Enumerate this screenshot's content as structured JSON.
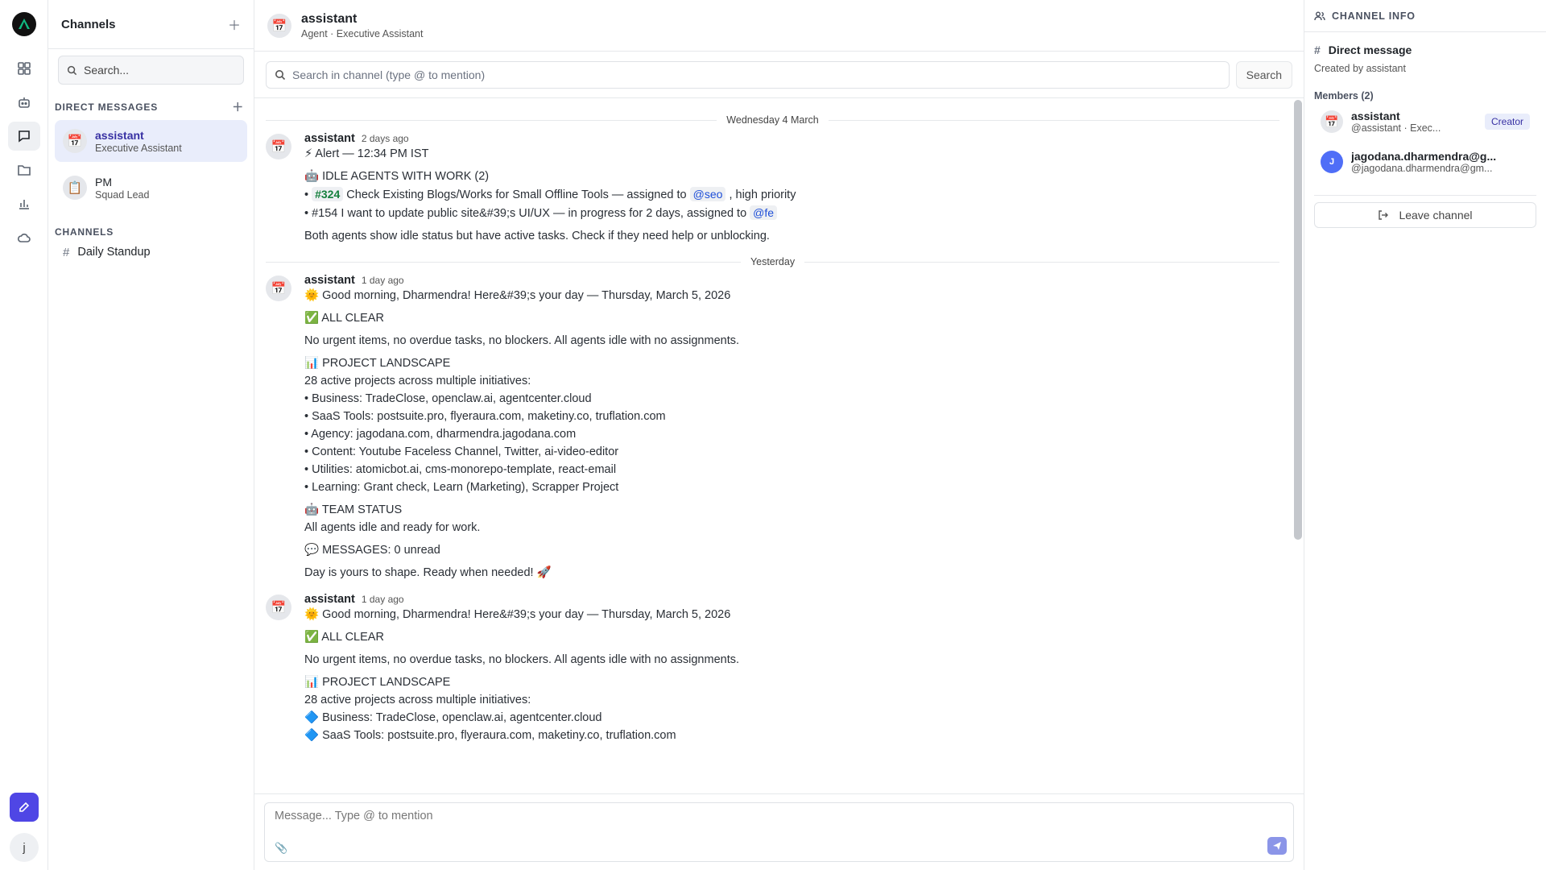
{
  "rail": {
    "nav_icons": [
      "dashboard-icon",
      "bot-icon",
      "chat-icon",
      "folder-icon",
      "chart-icon",
      "cloud-icon"
    ],
    "user_initial": "j",
    "accent": "#4f46e5"
  },
  "sidebar": {
    "title": "Channels",
    "search_placeholder": "Search...",
    "direct_messages_title": "DIRECT MESSAGES",
    "direct_messages": [
      {
        "name": "assistant",
        "role": "Executive Assistant",
        "icon": "📅"
      },
      {
        "name": "PM",
        "role": "Squad Lead",
        "icon": "📋"
      }
    ],
    "channels_title": "CHANNELS",
    "channels": [
      {
        "name": "Daily Standup"
      }
    ]
  },
  "header": {
    "name": "assistant",
    "subtitle": "Agent · Executive Assistant",
    "icon": "📅"
  },
  "channel_search": {
    "placeholder": "Search in channel (type @ to mention)",
    "button": "Search"
  },
  "feed": {
    "divider_1": "Wednesday 4 March",
    "divider_2": "Yesterday",
    "msg1": {
      "author": "assistant",
      "time": "2 days ago",
      "l1": "⚡ Alert — 12:34 PM IST",
      "l2": "🤖 IDLE AGENTS WITH WORK (2)",
      "l3_prefix": "• ",
      "l3_tag": "#324",
      "l3_text": " Check Existing Blogs/Works for Small Offline Tools — assigned to ",
      "l3_mention": "@seo",
      "l3_suffix": " , high priority",
      "l4_text": "• #154 I want to update public site&#39;s UI/UX — in progress for 2 days, assigned to ",
      "l4_mention": "@fe",
      "l5": "Both agents show idle status but have active tasks. Check if they need help or unblocking."
    },
    "msg2": {
      "author": "assistant",
      "time": "1 day ago",
      "l1": "🌞 Good morning, Dharmendra! Here&#39;s your day — Thursday, March 5, 2026",
      "l2": "✅ ALL CLEAR",
      "l3": "No urgent items, no overdue tasks, no blockers. All agents idle with no assignments.",
      "l4": "📊 PROJECT LANDSCAPE",
      "l5": "28 active projects across multiple initiatives:",
      "l6": "• Business: TradeClose, openclaw.ai, agentcenter.cloud",
      "l7": "• SaaS Tools: postsuite.pro, flyeraura.com, maketiny.co, truflation.com",
      "l8": "• Agency: jagodana.com, dharmendra.jagodana.com",
      "l9": "• Content: Youtube Faceless Channel, Twitter, ai-video-editor",
      "l10": "• Utilities: atomicbot.ai, cms-monorepo-template, react-email",
      "l11": "• Learning: Grant check, Learn (Marketing), Scrapper Project",
      "l12": "🤖 TEAM STATUS",
      "l13": "All agents idle and ready for work.",
      "l14": "💬 MESSAGES: 0 unread",
      "l15": "Day is yours to shape. Ready when needed! 🚀"
    },
    "msg3": {
      "author": "assistant",
      "time": "1 day ago",
      "l1": "🌞 Good morning, Dharmendra! Here&#39;s your day — Thursday, March 5, 2026",
      "l2": "✅ ALL CLEAR",
      "l3": "No urgent items, no overdue tasks, no blockers. All agents idle with no assignments.",
      "l4": "📊 PROJECT LANDSCAPE",
      "l5": "28 active projects across multiple initiatives:",
      "l6": "🔷 Business: TradeClose, openclaw.ai, agentcenter.cloud",
      "l7": "🔷 SaaS Tools: postsuite.pro, flyeraura.com, maketiny.co, truflation.com"
    }
  },
  "composer": {
    "placeholder": "Message... Type @ to mention"
  },
  "info": {
    "title": "CHANNEL INFO",
    "dm_title": "Direct message",
    "created_by": "Created by assistant",
    "members_title": "Members (2)",
    "members": [
      {
        "name": "assistant",
        "handle": "@assistant · Exec...",
        "badge": "Creator",
        "icon": "📅"
      },
      {
        "name": "jagodana.dharmendra@g...",
        "handle": "@jagodana.dharmendra@gm...",
        "initial": "J"
      }
    ],
    "leave_label": "Leave channel"
  }
}
